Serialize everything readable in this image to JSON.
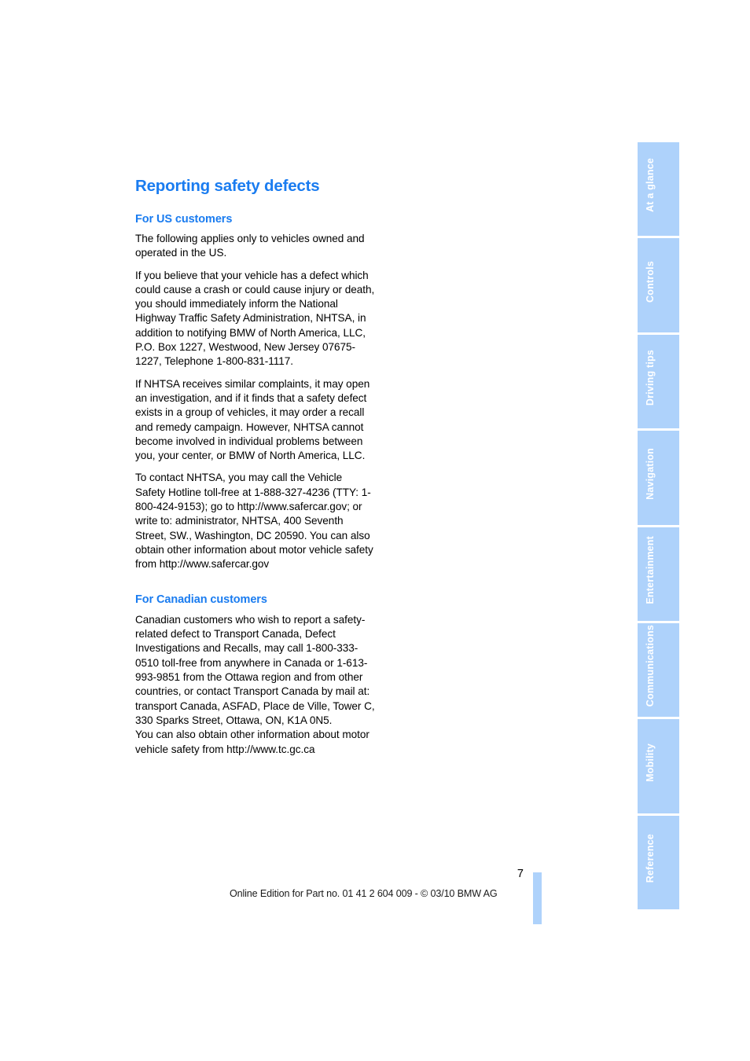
{
  "document": {
    "chapter_title": "Reporting safety defects"
  },
  "sections": [
    {
      "heading": "For US customers",
      "paragraphs": [
        "The following applies only to vehicles owned and operated in the US.",
        "If you believe that your vehicle has a defect which could cause a crash or could cause injury or death, you should immediately inform the National Highway Traffic Safety Administration, NHTSA, in addition to notifying BMW of North America, LLC, P.O. Box 1227, Westwood, New Jersey 07675-1227, Telephone 1-800-831-1117.",
        "If NHTSA receives similar complaints, it may open an investigation, and if it finds that a safety defect exists in a group of vehicles, it may order a recall and remedy campaign. However, NHTSA cannot become involved in individual problems between you, your center, or BMW of North America, LLC.",
        "To contact NHTSA, you may call the Vehicle Safety Hotline toll-free at 1-888-327-4236 (TTY: 1-800-424-9153); go to http://www.safercar.gov; or write to: administrator, NHTSA, 400 Seventh Street, SW., Washington, DC 20590. You can also obtain other information about motor vehicle safety from http://www.safercar.gov"
      ]
    },
    {
      "heading": "For Canadian customers",
      "paragraphs": [
        "Canadian customers who wish to report a safety-related defect to Transport Canada, Defect Investigations and Recalls, may call 1-800-333-0510 toll-free from anywhere in Canada or 1-613-993-9851 from the Ottawa region and from other countries, or contact Transport Canada by mail at: transport Canada, ASFAD, Place de Ville, Tower C, 330 Sparks Street, Ottawa, ON, K1A 0N5.\nYou can also obtain other information about motor vehicle safety from http://www.tc.gc.ca"
      ]
    }
  ],
  "side_tabs": [
    {
      "label": "At a glance"
    },
    {
      "label": "Controls"
    },
    {
      "label": "Driving tips"
    },
    {
      "label": "Navigation"
    },
    {
      "label": "Entertainment"
    },
    {
      "label": "Communications"
    },
    {
      "label": "Mobility"
    },
    {
      "label": "Reference"
    }
  ],
  "footer": {
    "page_number": "7",
    "note": "Online Edition for Part no. 01 41 2 604 009 - © 03/10 BMW AG"
  },
  "colors": {
    "accent_blue": "#1a7cf0",
    "tab_blue": "#aed2fb",
    "text_black": "#000000"
  }
}
